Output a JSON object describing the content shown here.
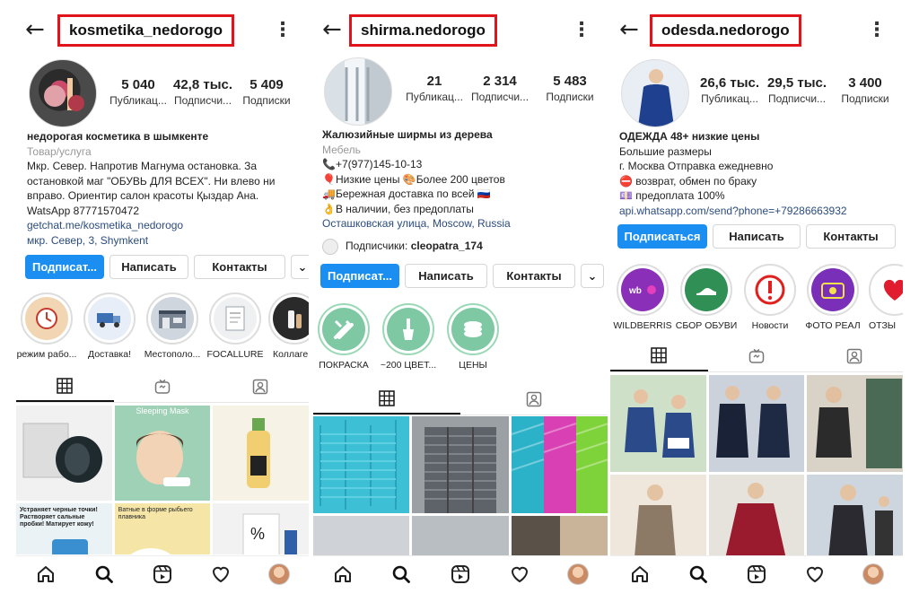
{
  "profiles": [
    {
      "username": "kosmetika_nedorogo",
      "stats": [
        {
          "num": "5 040",
          "label": "Публикац..."
        },
        {
          "num": "42,8 тыс.",
          "label": "Подписчи..."
        },
        {
          "num": "5 409",
          "label": "Подписки"
        }
      ],
      "bio": {
        "name": "недорогая косметика в шымкенте",
        "category": "Товар/услуга",
        "lines": [
          "Мкр. Север. Напротив Магнума остановка. За",
          "остановкой маг \"ОБУВЬ ДЛЯ ВСЕХ\". Ни влево ни",
          "вправо. Ориентир салон красоты Қыздар Ана.",
          "WatsApp 87771570472"
        ],
        "link": "getchat.me/kosmetika_nedorogo",
        "address": "мкр. Север, 3, Shymkent"
      },
      "buttons": {
        "follow": "Подписат...",
        "message": "Написать",
        "contacts": "Контакты",
        "more": "⌄"
      },
      "highlights": [
        {
          "label": "режим рабо...",
          "icon": "schedule-icon",
          "color": "#f2d6b3"
        },
        {
          "label": "Доставка!",
          "icon": "delivery-icon",
          "color": "#e7eef7"
        },
        {
          "label": "Местополо...",
          "icon": "store-icon",
          "color": "#cfd6de"
        },
        {
          "label": "FOCALLURE",
          "icon": "certificate-icon",
          "color": "#eef0f2"
        },
        {
          "label": "Коллаге...",
          "icon": "cosmetics-icon",
          "color": "#2a2a2a"
        }
      ],
      "posts": [
        {
          "caption": "",
          "color": "#f1f1f1"
        },
        {
          "caption": "Sleeping Mask",
          "color": "#9fd1b7"
        },
        {
          "caption": "",
          "color": "#f6f2e6"
        },
        {
          "caption": "Устраняет черные точки! Растворяет сальные пробки! Матирует кожу!",
          "color": "#eaf2f6"
        },
        {
          "caption": "Ватные в форме рыбьего плавника",
          "color": "#f5e6a8"
        },
        {
          "caption": "",
          "color": "#f2f2f2"
        }
      ]
    },
    {
      "username": "shirma.nedorogo",
      "stats": [
        {
          "num": "21",
          "label": "Публикац..."
        },
        {
          "num": "2 314",
          "label": "Подписчи..."
        },
        {
          "num": "5 483",
          "label": "Подписки"
        }
      ],
      "bio": {
        "name": "Жалюзийные ширмы из дерева",
        "category": "Мебель",
        "lines": [
          "📞+7(977)145-10-13",
          "🎈Низкие цены 🎨Более 200 цветов",
          "🚚Бережная доставка по всей 🇷🇺",
          "👌В наличии, без предоплаты"
        ],
        "link": "Осташковская улица, Moscow, Russia",
        "followers_prefix": "Подписчики:",
        "followers_user": "cleopatra_174"
      },
      "buttons": {
        "follow": "Подписат...",
        "message": "Написать",
        "contacts": "Контакты",
        "more": "⌄"
      },
      "highlights": [
        {
          "label": "ПОКРАСКА",
          "icon": "tools-icon",
          "color": "#7ec9a4"
        },
        {
          "label": "~200 ЦВЕТ...",
          "icon": "brush-icon",
          "color": "#7ec9a4"
        },
        {
          "label": "ЦЕНЫ",
          "icon": "money-icon",
          "color": "#7ec9a4"
        }
      ],
      "posts": [
        {
          "caption": "",
          "color": "#3dbfd6"
        },
        {
          "caption": "",
          "color": "#6c7177"
        },
        {
          "caption": "",
          "color": "#d940b3"
        },
        {
          "caption": "",
          "color": "#cfd3d7"
        },
        {
          "caption": "",
          "color": "#b9bec3"
        },
        {
          "caption": "",
          "color": "#5a5148"
        }
      ]
    },
    {
      "username": "odesda.nedorogo",
      "stats": [
        {
          "num": "26,6 тыс.",
          "label": "Публикац..."
        },
        {
          "num": "29,5 тыс.",
          "label": "Подписчи..."
        },
        {
          "num": "3 400",
          "label": "Подписки"
        }
      ],
      "bio": {
        "name": "ОДЕЖДА 48+ низкие цены",
        "lines": [
          "Большие размеры",
          "г. Москва Отправка ежедневно",
          "⛔ возврат, обмен по браку",
          "💷 предоплата 100%"
        ],
        "link": "api.whatsapp.com/send?phone=+79286663932"
      },
      "buttons": {
        "follow": "Подписаться",
        "message": "Написать",
        "contacts": "Контакты"
      },
      "highlights": [
        {
          "label": "WILDBERRIS",
          "icon": "wildberries-icon",
          "color": "#8a2fb8"
        },
        {
          "label": "СБОР ОБУВИ",
          "icon": "shoes-icon",
          "color": "#2f8f55"
        },
        {
          "label": "Новости",
          "icon": "alert-icon",
          "color": "#ffffff"
        },
        {
          "label": "ФОТО РЕАЛ",
          "icon": "photo-icon",
          "color": "#7a2fb8"
        },
        {
          "label": "ОТЗЫ",
          "icon": "heart-icon",
          "color": "#ffffff"
        }
      ],
      "posts": [
        {
          "caption": "",
          "color": "#2a4a8a"
        },
        {
          "caption": "",
          "color": "#1a2238"
        },
        {
          "caption": "",
          "color": "#2b2b2b"
        },
        {
          "caption": "",
          "color": "#8c7a66"
        },
        {
          "caption": "",
          "color": "#9b1b2e"
        },
        {
          "caption": "",
          "color": "#2a2a30"
        }
      ]
    }
  ],
  "nav_icons": [
    "home-icon",
    "search-icon",
    "reels-icon",
    "heart-icon",
    "profile-avatar"
  ]
}
